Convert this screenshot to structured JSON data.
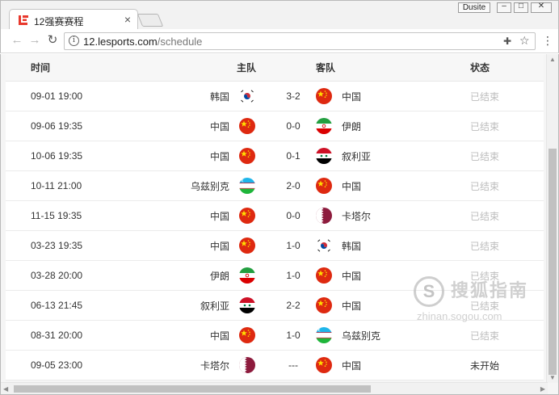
{
  "browser": {
    "tab_title": "12强赛赛程",
    "user_label": "Dusite",
    "url_host": "12.lesports.com",
    "url_path": "/schedule",
    "colors": {
      "brand_red": "#e8382c",
      "muted_status": "#bdbdbd"
    }
  },
  "table": {
    "headers": {
      "time": "时间",
      "home": "主队",
      "away": "客队",
      "status": "状态"
    },
    "rows": [
      {
        "time": "09-01 19:00",
        "home": "韩国",
        "home_flag": "korea-flag-icon",
        "score": "3-2",
        "away": "中国",
        "away_flag": "china-flag-icon",
        "status": "已结束"
      },
      {
        "time": "09-06 19:35",
        "home": "中国",
        "home_flag": "china-flag-icon",
        "score": "0-0",
        "away": "伊朗",
        "away_flag": "iran-flag-icon",
        "status": "已结束"
      },
      {
        "time": "10-06 19:35",
        "home": "中国",
        "home_flag": "china-flag-icon",
        "score": "0-1",
        "away": "叙利亚",
        "away_flag": "syria-flag-icon",
        "status": "已结束"
      },
      {
        "time": "10-11 21:00",
        "home": "乌兹别克",
        "home_flag": "uzbekistan-flag-icon",
        "score": "2-0",
        "away": "中国",
        "away_flag": "china-flag-icon",
        "status": "已结束"
      },
      {
        "time": "11-15 19:35",
        "home": "中国",
        "home_flag": "china-flag-icon",
        "score": "0-0",
        "away": "卡塔尔",
        "away_flag": "qatar-flag-icon",
        "status": "已结束"
      },
      {
        "time": "03-23 19:35",
        "home": "中国",
        "home_flag": "china-flag-icon",
        "score": "1-0",
        "away": "韩国",
        "away_flag": "korea-flag-icon",
        "status": "已结束"
      },
      {
        "time": "03-28 20:00",
        "home": "伊朗",
        "home_flag": "iran-flag-icon",
        "score": "1-0",
        "away": "中国",
        "away_flag": "china-flag-icon",
        "status": "已结束"
      },
      {
        "time": "06-13 21:45",
        "home": "叙利亚",
        "home_flag": "syria-flag-icon",
        "score": "2-2",
        "away": "中国",
        "away_flag": "china-flag-icon",
        "status": "已结束"
      },
      {
        "time": "08-31 20:00",
        "home": "中国",
        "home_flag": "china-flag-icon",
        "score": "1-0",
        "away": "乌兹别克",
        "away_flag": "uzbekistan-flag-icon",
        "status": "已结束"
      },
      {
        "time": "09-05 23:00",
        "home": "卡塔尔",
        "home_flag": "qatar-flag-icon",
        "score": "---",
        "away": "中国",
        "away_flag": "china-flag-icon",
        "status": "未开始"
      }
    ]
  },
  "watermark": {
    "text": "搜狐指南",
    "sub": "zhinan.sogou.com",
    "glyph": "S"
  }
}
